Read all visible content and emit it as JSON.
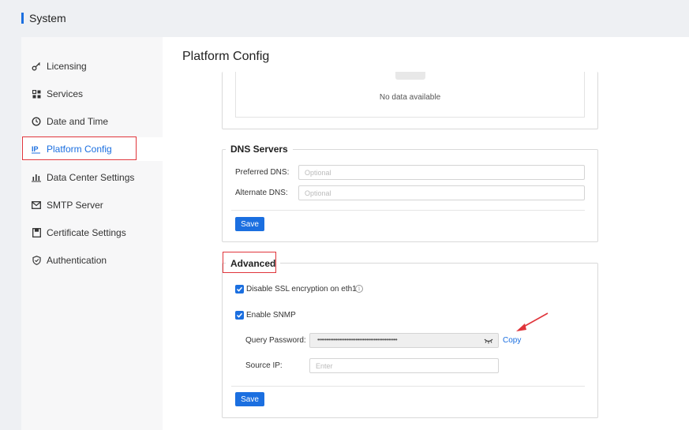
{
  "header": {
    "title": "System"
  },
  "sidebar": {
    "items": [
      {
        "label": "Licensing",
        "icon": "key-icon"
      },
      {
        "label": "Services",
        "icon": "grid-icon"
      },
      {
        "label": "Date and Time",
        "icon": "clock-icon"
      },
      {
        "label": "Platform Config",
        "icon": "ip-icon",
        "active": true
      },
      {
        "label": "Data Center Settings",
        "icon": "bar-chart-icon"
      },
      {
        "label": "SMTP Server",
        "icon": "mail-icon"
      },
      {
        "label": "Certificate Settings",
        "icon": "certificate-icon"
      },
      {
        "label": "Authentication",
        "icon": "shield-icon"
      }
    ]
  },
  "main": {
    "title": "Platform Config",
    "top_section": {
      "empty_text": "No data available"
    },
    "dns": {
      "legend": "DNS Servers",
      "preferred_label": "Preferred DNS:",
      "preferred_placeholder": "Optional",
      "alternate_label": "Alternate DNS:",
      "alternate_placeholder": "Optional",
      "save_label": "Save"
    },
    "advanced": {
      "legend": "Advanced",
      "ssl_label": "Disable SSL encryption on eth1",
      "ssl_checked": true,
      "snmp_label": "Enable SNMP",
      "snmp_checked": true,
      "query_password_label": "Query Password:",
      "query_password_value": "••••••••••••••••••••••••••••••••••••••••••••",
      "copy_label": "Copy",
      "source_ip_label": "Source IP:",
      "source_ip_placeholder": "Enter",
      "save_label": "Save"
    }
  },
  "colors": {
    "accent": "#1b6fe0",
    "highlight": "#e0353b"
  }
}
